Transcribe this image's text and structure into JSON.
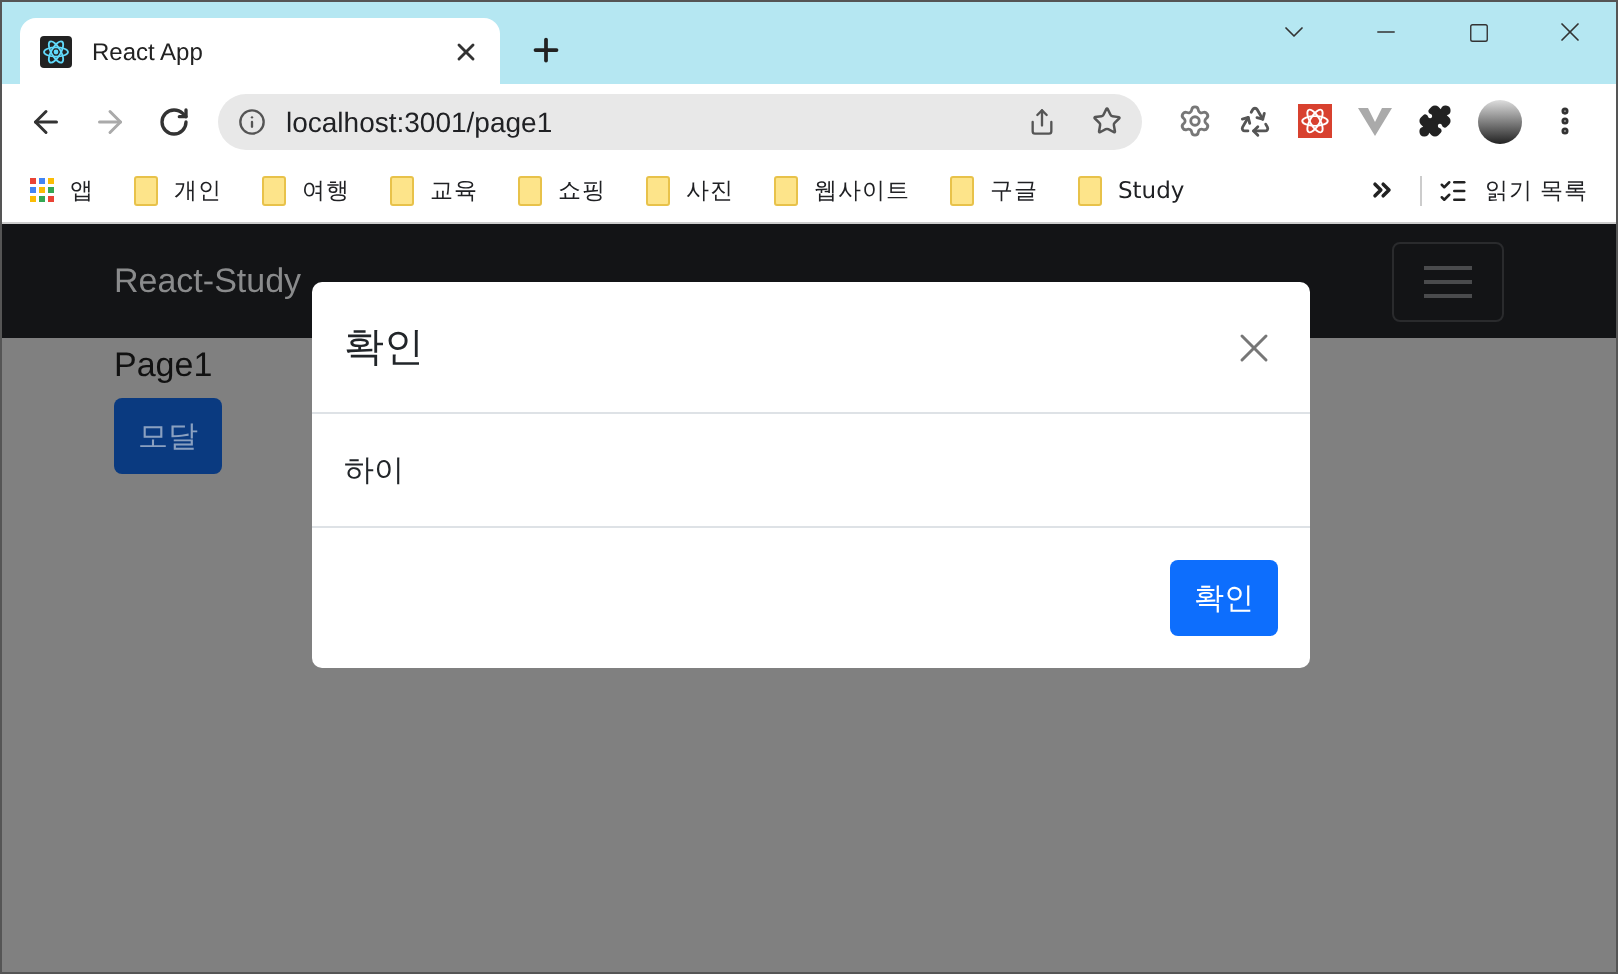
{
  "browser": {
    "tab": {
      "title": "React App",
      "selected": true
    },
    "address": "localhost:3001/page1",
    "bookmarks": [
      {
        "label": "앱",
        "kind": "apps"
      },
      {
        "label": "개인",
        "kind": "folder"
      },
      {
        "label": "여행",
        "kind": "folder"
      },
      {
        "label": "교육",
        "kind": "folder"
      },
      {
        "label": "쇼핑",
        "kind": "folder"
      },
      {
        "label": "사진",
        "kind": "folder"
      },
      {
        "label": "웹사이트",
        "kind": "folder"
      },
      {
        "label": "구글",
        "kind": "folder"
      },
      {
        "label": "Study",
        "kind": "folder"
      }
    ],
    "reading_list": "읽기 목록"
  },
  "page": {
    "brand": "React-Study",
    "heading": "Page1",
    "button": "모달"
  },
  "modal": {
    "title": "확인",
    "body": "하이",
    "button": "확인"
  }
}
